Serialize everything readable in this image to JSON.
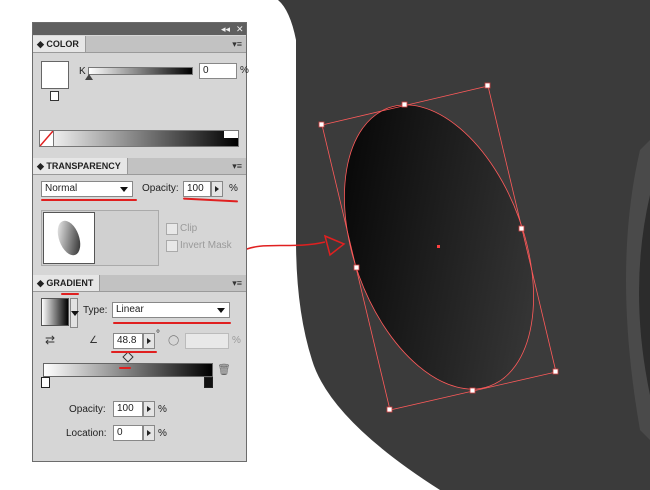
{
  "panel": {
    "collapse_icon": "double-arrow-icon",
    "close_icon": "close-icon"
  },
  "color": {
    "tab": "COLOR",
    "channel_label": "K",
    "value": "0",
    "unit": "%"
  },
  "transparency": {
    "tab": "TRANSPARENCY",
    "blend_mode": "Normal",
    "opacity_label": "Opacity:",
    "opacity_value": "100",
    "unit": "%",
    "clip_label": "Clip",
    "invert_mask_label": "Invert Mask"
  },
  "gradient": {
    "tab": "GRADIENT",
    "type_label": "Type:",
    "type_value": "Linear",
    "angle_value": "48.8",
    "degree_symbol": "°",
    "aspect_unit": "%",
    "opacity_label": "Opacity:",
    "opacity_value": "100",
    "location_label": "Location:",
    "location_value": "0",
    "unit": "%"
  },
  "colors": {
    "accent_red": "#e02020",
    "artboard_gray": "#3b3b3b",
    "panel_bg": "#d6d6d6"
  }
}
